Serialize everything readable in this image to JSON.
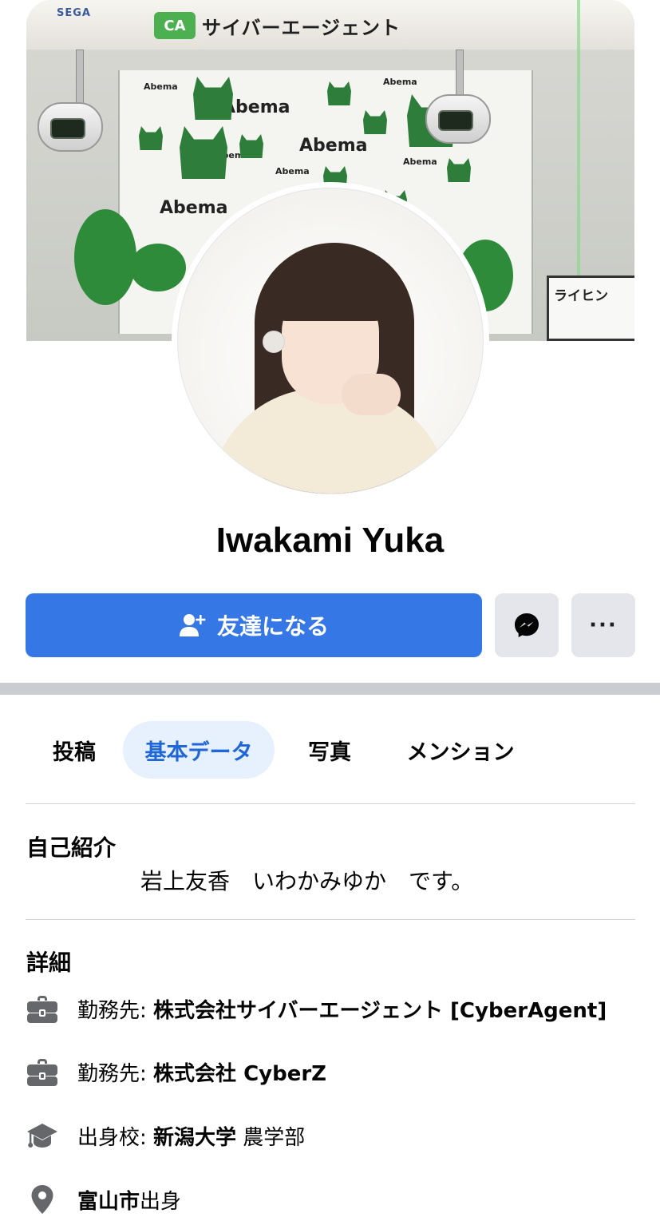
{
  "cover": {
    "brand_small": "SEGA",
    "brand_logo_mark": "CA",
    "brand_logo_text": "サイバーエージェント",
    "backdrop_word": "Abema",
    "sign_text": "ライヒン"
  },
  "profile": {
    "name": "Iwakami Yuka"
  },
  "actions": {
    "add_friend_label": "友達になる",
    "add_friend_icon": "person-add-icon",
    "messenger_icon": "messenger-icon",
    "more_icon": "more-icon",
    "more_glyph": "···"
  },
  "tabs": [
    {
      "label": "投稿",
      "active": false
    },
    {
      "label": "基本データ",
      "active": true
    },
    {
      "label": "写真",
      "active": false
    },
    {
      "label": "メンション",
      "active": false
    }
  ],
  "intro": {
    "title": "自己紹介",
    "bio": "岩上友香　いわかみゆか　です。"
  },
  "details": {
    "title": "詳細",
    "items": [
      {
        "icon": "briefcase-icon",
        "label": "勤務先: ",
        "value": "株式会社サイバーエージェント [CyberAgent]",
        "suffix": ""
      },
      {
        "icon": "briefcase-icon",
        "label": "勤務先: ",
        "value": "株式会社 CyberZ",
        "suffix": ""
      },
      {
        "icon": "graduation-cap-icon",
        "label": "出身校: ",
        "value": "新潟大学",
        "suffix": " 農学部"
      },
      {
        "icon": "location-pin-icon",
        "label": "",
        "value": "富山市",
        "suffix": "出身"
      }
    ]
  },
  "colors": {
    "primary_button": "#3578e5",
    "active_tab_bg": "#e7f0fd",
    "active_tab_text": "#1f66d6",
    "secondary_button": "#e4e6eb",
    "icon_gray": "#65676b"
  }
}
